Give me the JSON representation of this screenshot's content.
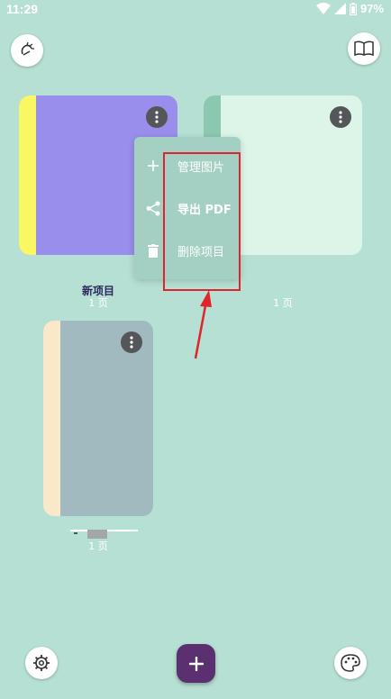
{
  "status": {
    "time": "11:29",
    "battery": "97%"
  },
  "toolbar": {
    "left_icon": "sticker-icon",
    "right_icon": "book-icon"
  },
  "projects": [
    {
      "title": "新项目",
      "pages": "1 页",
      "cover_color": "#9a8eec",
      "spine_color": "#faf764"
    },
    {
      "title": "",
      "pages": "1 页",
      "cover_color": "#dcf5e8",
      "spine_color": "#8cc8b0"
    },
    {
      "title": "",
      "pages": "1 页",
      "cover_color": "#a1bac0",
      "spine_color": "#f9e9c8"
    }
  ],
  "context_menu": {
    "items": [
      {
        "label": "管理图片",
        "icon": "plus-icon"
      },
      {
        "label": "导出 PDF",
        "icon": "share-icon"
      },
      {
        "label": "删除项目",
        "icon": "trash-icon"
      }
    ]
  },
  "bottom": {
    "settings_icon": "gear-icon",
    "add_icon": "plus-icon",
    "theme_icon": "palette-icon"
  },
  "colors": {
    "background": "#b6e0d3",
    "fab": "#5b3070",
    "annotation": "#e0252a"
  }
}
